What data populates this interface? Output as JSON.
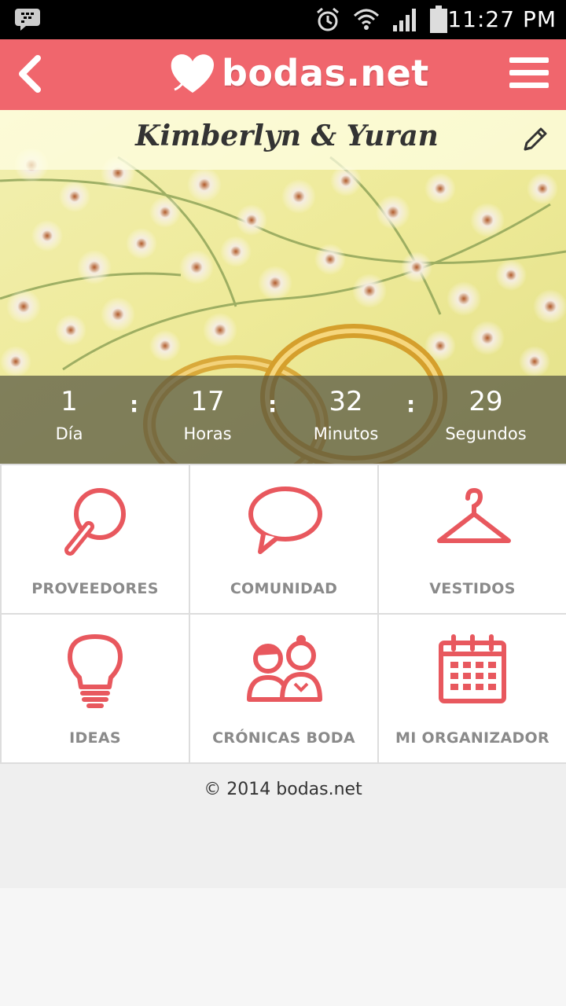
{
  "status_bar": {
    "time": "11:27 PM",
    "icons": [
      "bbm-icon",
      "alarm-icon",
      "wifi-icon",
      "signal-icon",
      "battery-icon"
    ]
  },
  "app_bar": {
    "brand": "bodas.net",
    "brand_color": "#f0666d",
    "icons": [
      "back-icon",
      "heart-logo-icon",
      "hamburger-menu-icon"
    ]
  },
  "hero": {
    "couple_names": "Kimberlyn & Yuran",
    "edit_icon": "pencil-icon"
  },
  "countdown": {
    "days": "1",
    "days_label": "Día",
    "hours": "17",
    "hours_label": "Horas",
    "minutes": "32",
    "minutes_label": "Minutos",
    "seconds": "29",
    "seconds_label": "Segundos",
    "separator": ":"
  },
  "menu": {
    "accent_color": "#e8585e",
    "items": [
      {
        "label": "PROVEEDORES",
        "icon": "magnifier-icon"
      },
      {
        "label": "COMUNIDAD",
        "icon": "speech-bubble-icon"
      },
      {
        "label": "VESTIDOS",
        "icon": "hanger-icon"
      },
      {
        "label": "IDEAS",
        "icon": "lightbulb-icon"
      },
      {
        "label": "CRÓNICAS BODA",
        "icon": "couple-icon"
      },
      {
        "label": "MI ORGANIZADOR",
        "icon": "calendar-icon"
      }
    ]
  },
  "footer": {
    "copyright": "© 2014 bodas.net"
  }
}
